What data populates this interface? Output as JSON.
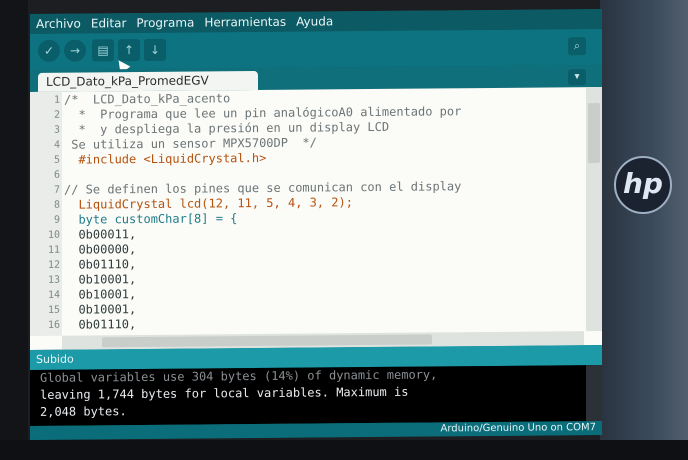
{
  "menu": [
    "Archivo",
    "Editar",
    "Programa",
    "Herramientas",
    "Ayuda"
  ],
  "toolbar": {
    "buttons": [
      "verify-icon",
      "upload-icon",
      "new-icon",
      "open-icon",
      "save-icon"
    ],
    "serial_monitor_icon": "serial-monitor-icon"
  },
  "tab": {
    "label": "LCD_Dato_kPa_PromedEGV"
  },
  "editor": {
    "line_numbers": [
      "1",
      "2",
      "3",
      "4",
      "5",
      "6",
      "7",
      "8",
      "9",
      "10",
      "11",
      "12",
      "13",
      "14",
      "15",
      "16"
    ],
    "lines": [
      "/*  LCD_Dato_kPa_acento",
      "  *  Programa que lee un pin analógicoA0 alimentado por",
      "  *  y despliega la presión en un display LCD",
      " Se utiliza un sensor MPX5700DP  */",
      "  #include <LiquidCrystal.h>",
      "",
      "// Se definen los pines que se comunican con el display",
      "  LiquidCrystal lcd(12, 11, 5, 4, 3, 2);",
      "  byte customChar[8] = {",
      "  0b00011,",
      "  0b00000,",
      "  0b01110,",
      "  0b10001,",
      "  0b10001,",
      "  0b10001,",
      "  0b01110,"
    ]
  },
  "status": {
    "text": "Subido"
  },
  "console": {
    "lines": [
      "Global variables use 304 bytes (14%) of dynamic memory,",
      "leaving 1,744 bytes for local variables. Maximum is",
      "2,048 bytes."
    ]
  },
  "footer": {
    "board": "Arduino/Genuino Uno on COM7"
  },
  "colors": {
    "accent": "#0e7380",
    "status": "#1c9aa8",
    "keyword": "#b5520f"
  }
}
